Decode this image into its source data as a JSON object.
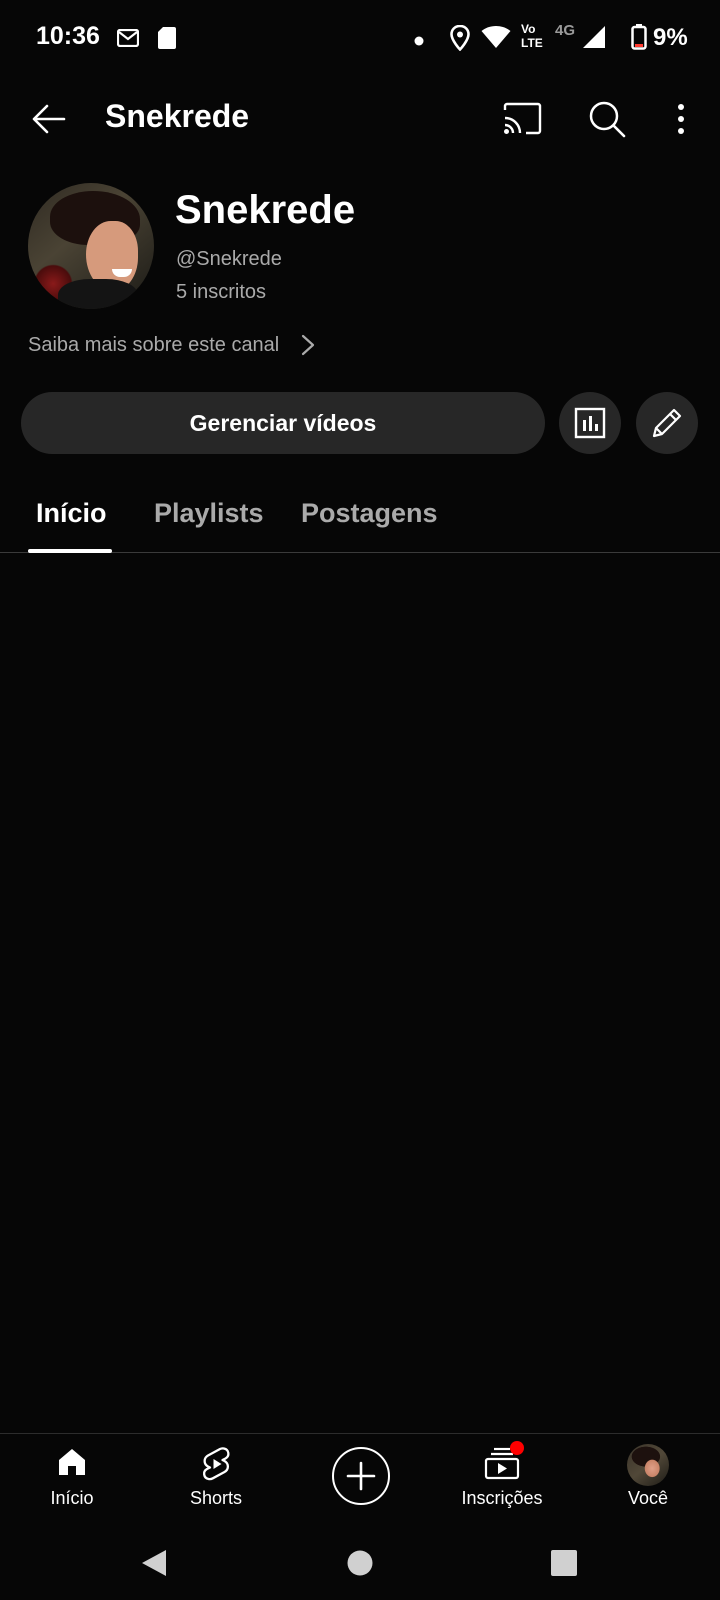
{
  "status_bar": {
    "time": "10:36",
    "network_label": "4G",
    "volte_line1": "Vo",
    "volte_line2": "LTE",
    "battery": "9%",
    "icons": [
      "gmail-icon",
      "sd-card-icon",
      "dot-icon",
      "location-icon",
      "wifi-icon",
      "volte-icon",
      "signal-icon",
      "battery-icon"
    ]
  },
  "appbar": {
    "title": "Snekrede",
    "icons": [
      "back-arrow-icon",
      "cast-icon",
      "search-icon",
      "more-vert-icon"
    ]
  },
  "channel": {
    "name": "Snekrede",
    "handle": "@Snekrede",
    "subscribers": "5 inscritos",
    "about_link": "Saiba mais sobre este canal"
  },
  "actions": {
    "manage_label": "Gerenciar vídeos",
    "icons": [
      "analytics-icon",
      "edit-pencil-icon"
    ]
  },
  "tabs": [
    {
      "label": "Início",
      "active": true
    },
    {
      "label": "Playlists",
      "active": false
    },
    {
      "label": "Postagens",
      "active": false
    }
  ],
  "bottom_nav": [
    {
      "label": "Início",
      "icon": "home-icon"
    },
    {
      "label": "Shorts",
      "icon": "shorts-icon"
    },
    {
      "label": "",
      "icon": "create-plus-icon"
    },
    {
      "label": "Inscrições",
      "icon": "subscriptions-icon",
      "badge": true
    },
    {
      "label": "Você",
      "icon": "avatar"
    }
  ],
  "colors": {
    "background": "#060606",
    "button_bg": "#272727",
    "secondary_text": "#aaaaaa",
    "badge": "#ff0000"
  }
}
